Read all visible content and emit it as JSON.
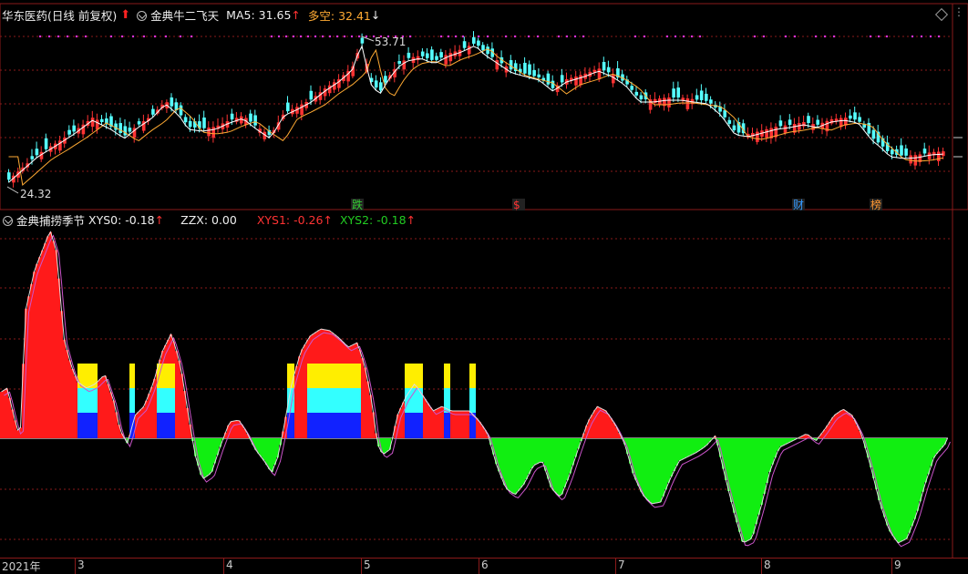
{
  "main_header": {
    "stock_name": "华东医药(日线 前复权)",
    "indicator_name": "金典牛二飞天",
    "ma5_label": "MA5: 31.65",
    "ma5_arrow": "↑",
    "duokong_label": "多空: 32.41",
    "duokong_arrow": "↓"
  },
  "price_annotations": {
    "high": "53.71",
    "low": "24.32"
  },
  "event_tags": [
    {
      "text": "跌",
      "color": "#33cc33"
    },
    {
      "text": "$",
      "color": "#ff3333"
    },
    {
      "text": "财",
      "color": "#3399ff"
    },
    {
      "text": "榜",
      "color": "#ff9933"
    }
  ],
  "sub_header": {
    "indicator_name": "金典捕捞季节",
    "xys0_label": "XYS0: -0.18",
    "xys0_arrow": "↑",
    "zzx_label": "ZZX: 0.00",
    "xys1_label": "XYS1: -0.26",
    "xys1_arrow": "↑",
    "xys2_label": "XYS2: -0.18",
    "xys2_arrow": "↑"
  },
  "x_axis": {
    "year_label": "2021年",
    "months": [
      "3",
      "4",
      "5",
      "6",
      "7",
      "8",
      "9"
    ]
  },
  "colors": {
    "up": "#ff3333",
    "down": "#55ffff",
    "ma5": "#ffffff",
    "duokong": "#ffaa33",
    "positive_hist": "#ff1a1a",
    "negative_hist": "#11ee11",
    "yellow": "#ffee00",
    "cyan": "#33ffff",
    "blue": "#1122ff",
    "grid": "#8a1a1a",
    "magenta_dots": "#dd33dd"
  },
  "chart_data": {
    "type": "candlestick+histogram",
    "price_high": 53.71,
    "price_low": 24.32,
    "ma5_last": 31.65,
    "duokong_last": 32.41,
    "oscillator_last": {
      "XYS0": -0.18,
      "ZZX": 0.0,
      "XYS1": -0.26,
      "XYS2": -0.18
    }
  }
}
